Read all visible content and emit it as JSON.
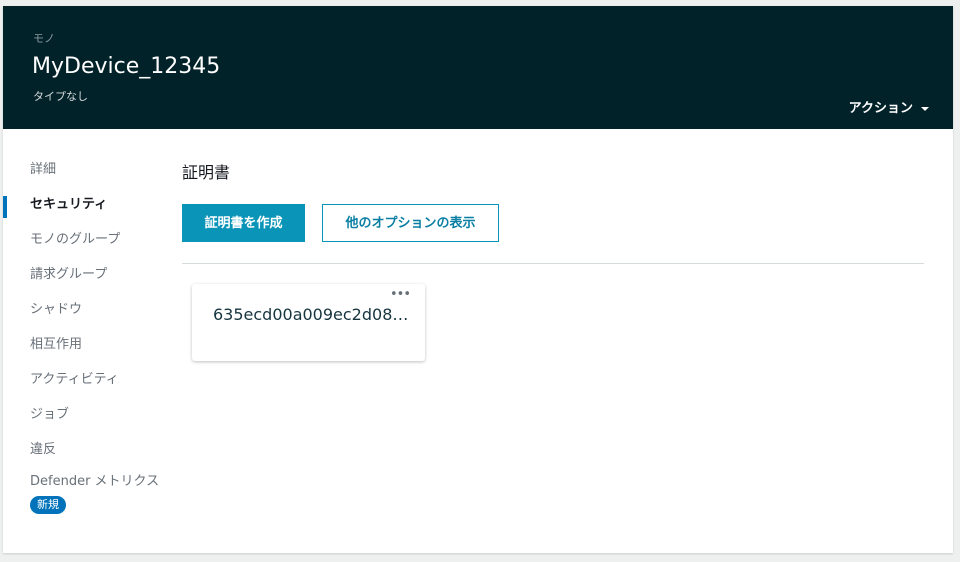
{
  "header": {
    "breadcrumb": "モノ",
    "title": "MyDevice_12345",
    "subtitle": "タイプなし",
    "actions_label": "アクション"
  },
  "sidebar": {
    "items": [
      {
        "label": "詳細"
      },
      {
        "label": "セキュリティ",
        "active": true
      },
      {
        "label": "モノのグループ"
      },
      {
        "label": "請求グループ"
      },
      {
        "label": "シャドウ"
      },
      {
        "label": "相互作用"
      },
      {
        "label": "アクティビティ"
      },
      {
        "label": "ジョブ"
      },
      {
        "label": "違反"
      },
      {
        "label": "Defender メトリクス"
      }
    ],
    "new_badge": "新規"
  },
  "main": {
    "section_title": "証明書",
    "create_button": "証明書を作成",
    "more_options_button": "他のオプションの表示",
    "certificates": [
      {
        "id": "635ecd00a009ec2d08…"
      }
    ]
  },
  "colors": {
    "header": "#012229",
    "primary": "#0a94b8",
    "badge": "#0073bb"
  }
}
